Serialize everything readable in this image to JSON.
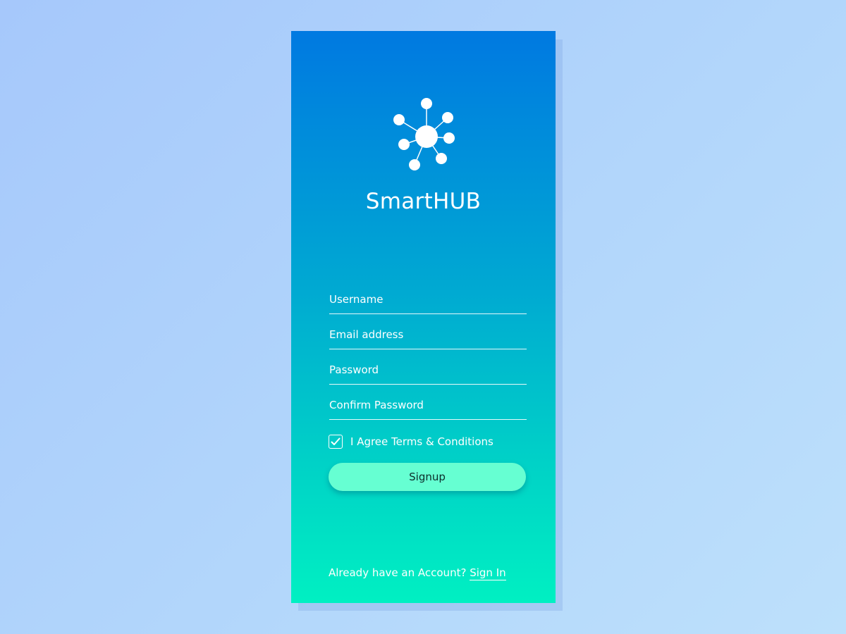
{
  "app": {
    "title": "SmartHUB",
    "logo_icon": "network-hub-icon"
  },
  "form": {
    "username": {
      "placeholder": "Username",
      "value": ""
    },
    "email": {
      "placeholder": "Email address",
      "value": ""
    },
    "password": {
      "placeholder": "Password",
      "value": ""
    },
    "confirm_password": {
      "placeholder": "Confirm Password",
      "value": ""
    },
    "agree": {
      "label": "I Agree Terms & Conditions",
      "checked": true,
      "icon": "checkmark-icon"
    },
    "submit_label": "Signup"
  },
  "footer": {
    "prompt": "Already have an Account?",
    "link_label": "Sign In"
  },
  "colors": {
    "gradient_top": "#0079e1",
    "gradient_bottom": "#00f0c2",
    "button": "#66ffd2",
    "background": "#b2d6fb"
  }
}
